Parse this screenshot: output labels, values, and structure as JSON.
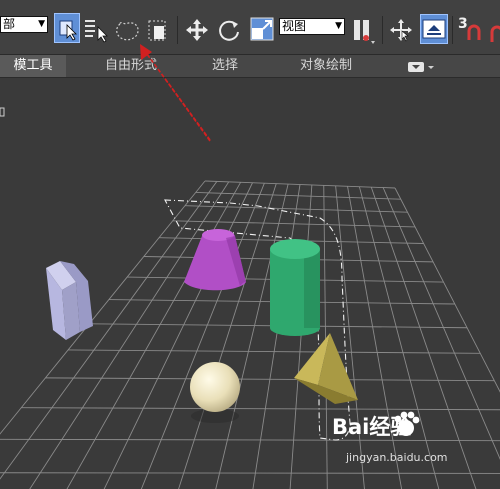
{
  "toolbar": {
    "left_dropdown_value": "部",
    "view_dropdown_value": "视图",
    "number_label": "3"
  },
  "ribbon": {
    "tabs": [
      {
        "label": "模工具"
      },
      {
        "label": "自由形式"
      },
      {
        "label": "选择"
      },
      {
        "label": "对象绘制"
      }
    ]
  },
  "viewport": {
    "objects": [
      "box",
      "cone",
      "cylinder",
      "sphere",
      "pyramid"
    ],
    "colors": {
      "box": "#b7b7e0",
      "cone": "#b14fc6",
      "cylinder": "#2fa86e",
      "sphere": "#e9dfb8",
      "pyramid": "#c9b85a",
      "grid": "#8a8a8a",
      "annotation_arrow": "#d22020"
    }
  },
  "watermark": {
    "brand": "Bai经验",
    "url": "jingyan.baidu.com"
  }
}
